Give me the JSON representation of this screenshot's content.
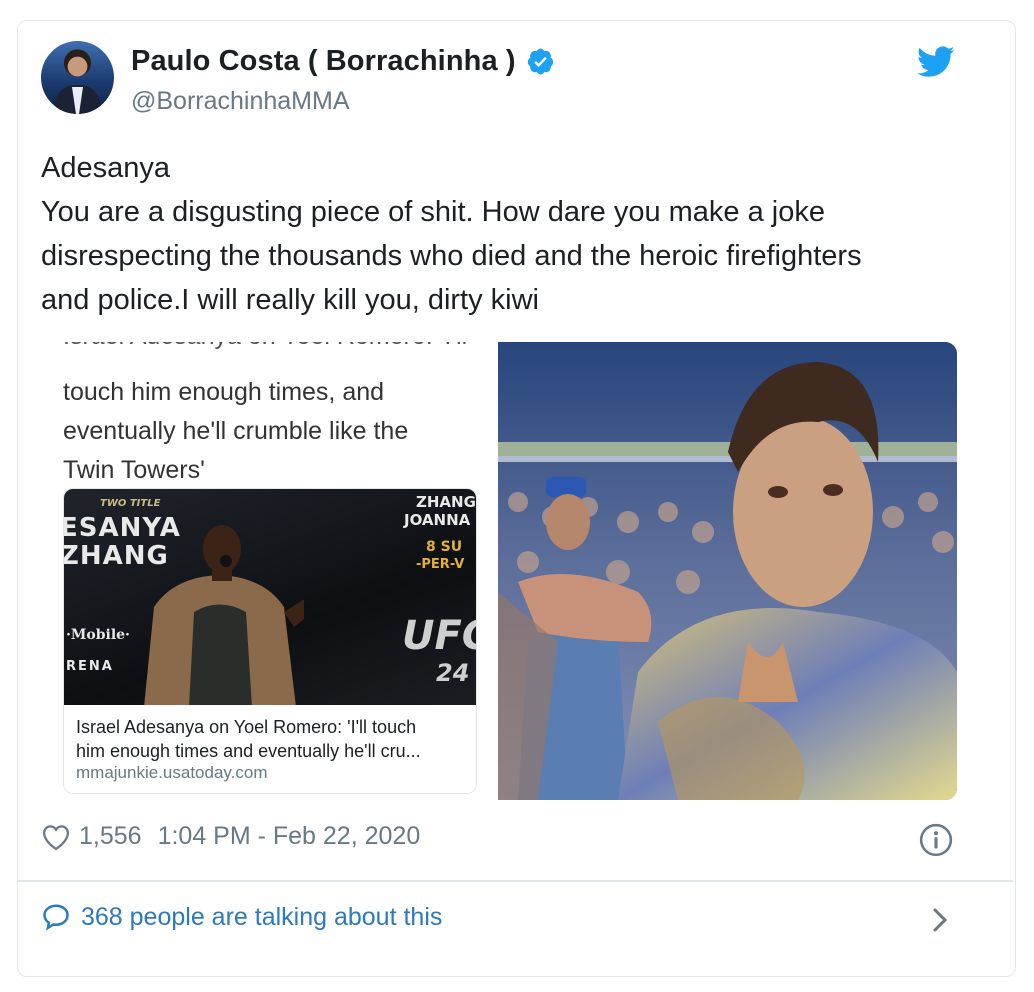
{
  "tweet": {
    "author": {
      "display_name": "Paulo Costa ( Borrachinha )",
      "handle": "@BorrachinhaMMA",
      "verified": true
    },
    "text_lines": [
      "Adesanya",
      "You are a disgusting piece of shit. How dare you make a joke",
      "disrespecting the thousands who died and the heroic firefighters",
      "and police.I will really kill you, dirty kiwi"
    ],
    "media": {
      "screenshot_text_lines": [
        "Israel Adesanya on Yoel Romero: 'I'll",
        "touch him enough times, and",
        "eventually he'll crumble like the",
        "Twin Towers'"
      ],
      "link_card": {
        "image_text": {
          "two_title": "TWO TITLE",
          "esanya": "ESANYA",
          "zhang": "ZHANG",
          "zhang_right": "ZHANG",
          "joanna": "JOANNA",
          "date": "8 SU",
          "ppv": "-PER-V",
          "mobile": "·Mobile·",
          "arena": "RENA",
          "ufc": "UFC",
          "ufc_num": "24"
        },
        "title_lines": [
          "Israel Adesanya on Yoel Romero: 'I'll touch",
          "him enough times and eventually he'll cru..."
        ],
        "domain": "mmajunkie.usatoday.com"
      }
    },
    "likes": "1,556",
    "timestamp": "1:04 PM - Feb 22, 2020",
    "talking": "368 people are talking about this"
  },
  "colors": {
    "link_blue": "#2b7bb9",
    "twitter_blue": "#1da1f2",
    "meta_gray": "#697882",
    "border": "#e1e8ed"
  },
  "icons": [
    "verified-badge-icon",
    "twitter-bird-icon",
    "heart-icon",
    "info-icon",
    "comment-bubble-icon",
    "chevron-right-icon"
  ]
}
